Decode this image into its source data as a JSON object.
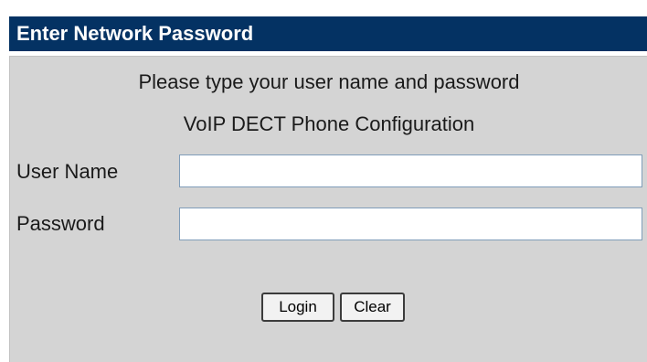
{
  "dialog": {
    "title": "Enter Network Password",
    "prompt": "Please type your user name and password",
    "realm": "VoIP DECT Phone Configuration"
  },
  "form": {
    "username_label": "User Name",
    "username_value": "",
    "password_label": "Password",
    "password_value": ""
  },
  "buttons": {
    "login_label": "Login",
    "clear_label": "Clear"
  },
  "colors": {
    "title_bar": "#043263",
    "panel": "#d4d4d4",
    "input_border": "#7f9db9"
  }
}
